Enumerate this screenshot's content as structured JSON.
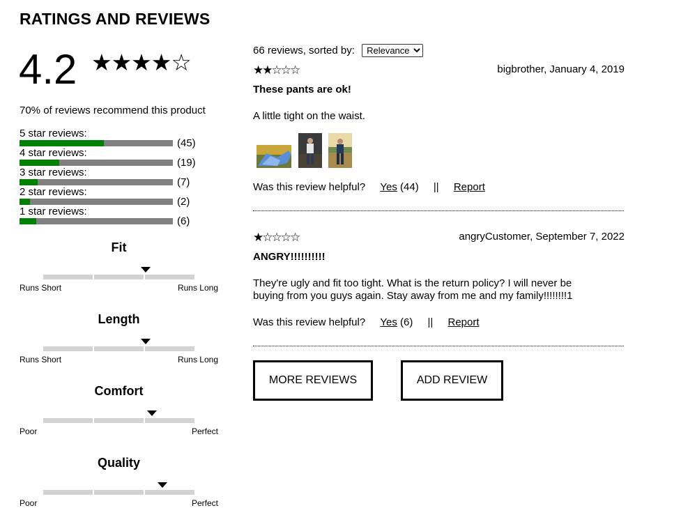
{
  "title": "RATINGS AND REVIEWS",
  "summary": {
    "average": "4.2",
    "stars": "★★★★☆",
    "recommend": "70% of reviews recommend this product"
  },
  "breakdown": [
    {
      "label": "5 star reviews:",
      "count": "(45)",
      "fill": 0.55
    },
    {
      "label": "4 star reviews:",
      "count": "(19)",
      "fill": 0.26
    },
    {
      "label": "3 star reviews:",
      "count": "(7)",
      "fill": 0.12
    },
    {
      "label": "2 star reviews:",
      "count": "(2)",
      "fill": 0.07
    },
    {
      "label": "1 star reviews:",
      "count": "(6)",
      "fill": 0.11
    }
  ],
  "factors": [
    {
      "name": "Fit",
      "low": "Runs Short",
      "high": "Runs Long",
      "value": 0.68
    },
    {
      "name": "Length",
      "low": "Runs Short",
      "high": "Runs Long",
      "value": 0.68
    },
    {
      "name": "Comfort",
      "low": "Poor",
      "high": "Perfect",
      "value": 0.72
    },
    {
      "name": "Quality",
      "low": "Poor",
      "high": "Perfect",
      "value": 0.79
    }
  ],
  "list": {
    "count_text": "66 reviews, sorted by:",
    "sort_options": [
      "Relevance"
    ],
    "sort_selected": "Relevance"
  },
  "reviews": [
    {
      "stars": "★★☆☆☆",
      "meta": "bigbrother, January 4, 2019",
      "title": "These pants are ok!",
      "body": "A little tight on the waist.",
      "photos": [
        "photo-yellow-blue",
        "photo-person-dark-field",
        "photo-person-grass-field"
      ],
      "helpful_q": "Was this review helpful?",
      "yes_label": "Yes",
      "yes_count": "(44)",
      "separator": "||",
      "report_label": "Report"
    },
    {
      "stars": "★☆☆☆☆",
      "meta": "angryCustomer, September 7, 2022",
      "title": "ANGRY!!!!!!!!!!",
      "body": "They're ugly and fit too tight. What is the return policy? I will never be buying from you guys again. Stay away from me and my family!!!!!!!!1",
      "photos": [],
      "helpful_q": "Was this review helpful?",
      "yes_label": "Yes",
      "yes_count": "(6)",
      "separator": "||",
      "report_label": "Report"
    }
  ],
  "buttons": {
    "more": "MORE REVIEWS",
    "add": "ADD REVIEW"
  },
  "colors": {
    "bar_fill": "#008000",
    "bar_track": "#808080",
    "factor_track": "#d3d3d3"
  }
}
